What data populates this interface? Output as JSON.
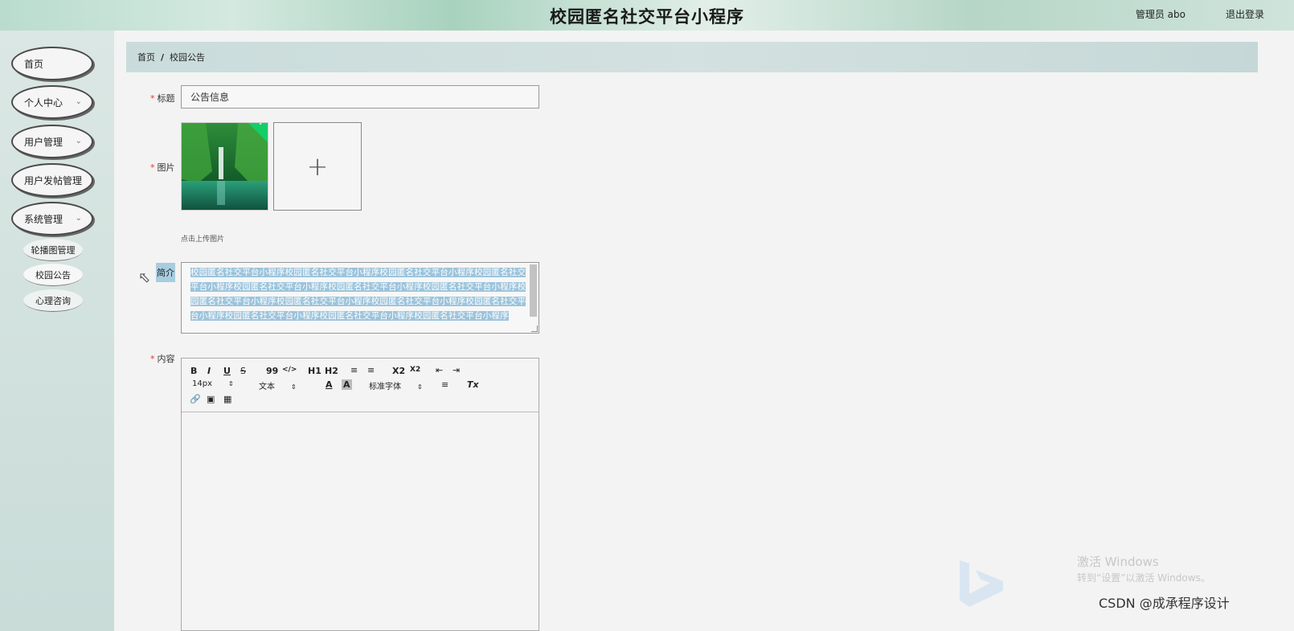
{
  "header": {
    "title": "校园匿名社交平台小程序",
    "admin": "管理员 abo",
    "logout": "退出登录"
  },
  "sidebar": {
    "items": [
      {
        "label": "首页"
      },
      {
        "label": "个人中心"
      },
      {
        "label": "用户管理"
      },
      {
        "label": "用户发帖管理"
      },
      {
        "label": "系统管理"
      }
    ],
    "subitems": [
      {
        "label": "轮播图管理"
      },
      {
        "label": "校园公告"
      },
      {
        "label": "心理咨询"
      }
    ]
  },
  "breadcrumb": {
    "home": "首页",
    "separator": "/",
    "current": "校园公告"
  },
  "form": {
    "title_label": "标题",
    "title_value": "公告信息",
    "image_label": "图片",
    "upload_tip": "点击上传图片",
    "intro_label": "简介",
    "intro_value": "校园匿名社交平台小程序校园匿名社交平台小程序校园匿名社交平台小程序校园匿名社交平台小程序校园匿名社交平台小程序校园匿名社交平台小程序校园匿名社交平台小程序校园匿名社交平台小程序校园匿名社交平台小程序校园匿名社交平台小程序校园匿名社交平台小程序校园匿名社交平台小程序校园匿名社交平台小程序校园匿名社交平台小程序",
    "content_label": "内容",
    "required_mark": "*"
  },
  "editor": {
    "font_size": "14px",
    "block_type": "文本",
    "font_family": "标准字体",
    "buttons": [
      "B",
      "I",
      "U",
      "S",
      "99",
      "</>",
      "H1",
      "H2",
      "ordered-list",
      "bullet-list",
      "X2",
      "X2",
      "outdent",
      "indent",
      "A",
      "A",
      "align",
      "Tx",
      "link",
      "image",
      "video"
    ]
  },
  "watermark": {
    "line1": "激活 Windows",
    "line2": "转到“设置”以激活 Windows。",
    "csdn": "CSDN @成承程序设计"
  },
  "colors": {
    "required": "#e0392c",
    "selection": "#9cc4dc",
    "upload_success": "#13ce66"
  }
}
